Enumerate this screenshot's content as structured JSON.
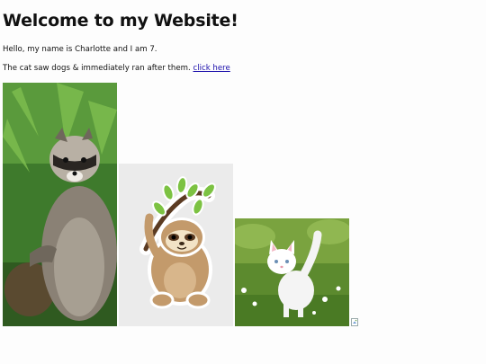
{
  "page": {
    "heading": "Welcome to my Website!",
    "intro": "Hello, my name is Charlotte and I am 7.",
    "story": "The cat saw dogs & immediately ran after them.",
    "link_text": "click here"
  },
  "images": [
    {
      "subject": "raccoon"
    },
    {
      "subject": "sloth"
    },
    {
      "subject": "kitten"
    },
    {
      "subject": "broken-image"
    }
  ],
  "colors": {
    "link": "#1a0dab",
    "background": "#fdfdfd"
  }
}
